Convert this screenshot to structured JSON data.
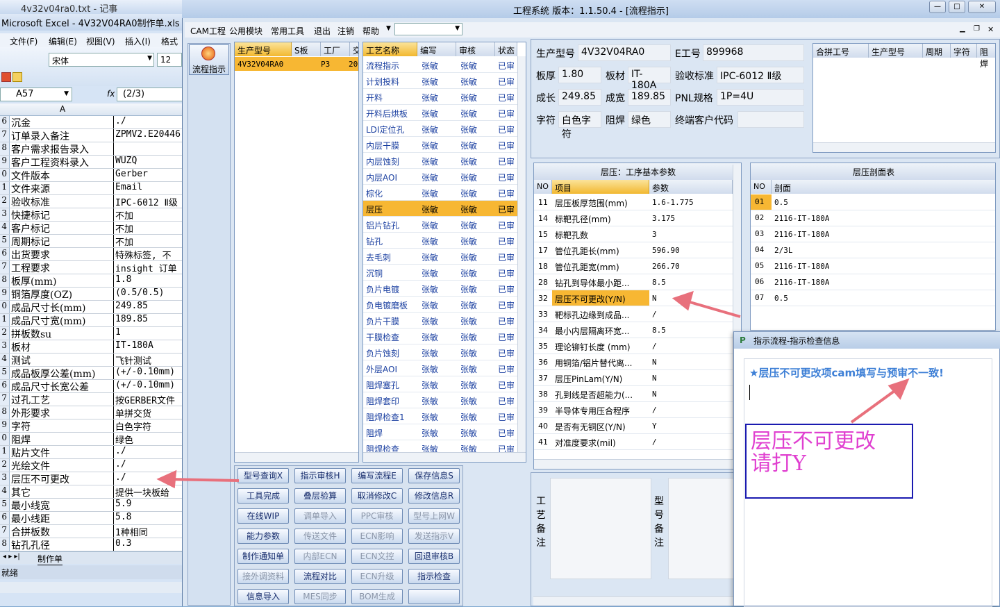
{
  "excel": {
    "title1": "4v32v04ra0.txt - 记事",
    "title2": "Microsoft Excel - 4V32V04RA0制作单.xls",
    "menu": [
      "文件(F)",
      "编辑(E)",
      "视图(V)",
      "插入(I)",
      "格式"
    ],
    "font": "宋体",
    "size": "12",
    "namebox": "A57",
    "fx_symbol": "fx",
    "formula": "(2/3)",
    "col_a": "A",
    "rows": [
      {
        "n": "6",
        "a": "沉金",
        "b": "./"
      },
      {
        "n": "7",
        "a": "订单录入备注",
        "b": "ZPMV2.E20446"
      },
      {
        "n": "8",
        "a": "客户需求报告录入",
        "b": ""
      },
      {
        "n": "9",
        "a": "客户工程资料录入",
        "b": "WUZQ"
      },
      {
        "n": "0",
        "a": "文件版本",
        "b": "Gerber"
      },
      {
        "n": "1",
        "a": "文件来源",
        "b": "Email"
      },
      {
        "n": "2",
        "a": "验收标准",
        "b": "IPC-6012 Ⅱ级"
      },
      {
        "n": "3",
        "a": "快捷标记",
        "b": "不加"
      },
      {
        "n": "4",
        "a": "客户标记",
        "b": "不加"
      },
      {
        "n": "5",
        "a": "周期标记",
        "b": "不加"
      },
      {
        "n": "6",
        "a": "出货要求",
        "b": "特殊标签, 不"
      },
      {
        "n": "7",
        "a": "工程要求",
        "b": "insight 订单"
      },
      {
        "n": "8",
        "a": "板厚(mm)",
        "b": "1.8"
      },
      {
        "n": "9",
        "a": "铜箔厚度(OZ)",
        "b": "(0.5/0.5)"
      },
      {
        "n": "0",
        "a": "成品尺寸长(mm)",
        "b": "249.85"
      },
      {
        "n": "1",
        "a": "成品尺寸宽(mm)",
        "b": "189.85"
      },
      {
        "n": "2",
        "a": "拼板数su",
        "b": "1"
      },
      {
        "n": "3",
        "a": "板材",
        "b": "IT-180A"
      },
      {
        "n": "4",
        "a": "测试",
        "b": "飞针测试"
      },
      {
        "n": "5",
        "a": "成品板厚公差(mm)",
        "b": "(+/-0.10mm)"
      },
      {
        "n": "6",
        "a": "成品尺寸长宽公差",
        "b": "(+/-0.10mm)"
      },
      {
        "n": "7",
        "a": "过孔工艺",
        "b": "按GERBER文件"
      },
      {
        "n": "8",
        "a": "外形要求",
        "b": "单拼交货"
      },
      {
        "n": "9",
        "a": "字符",
        "b": "白色字符"
      },
      {
        "n": "0",
        "a": "阻焊",
        "b": "绿色"
      },
      {
        "n": "1",
        "a": "贴片文件",
        "b": "./"
      },
      {
        "n": "2",
        "a": "光绘文件",
        "b": "./"
      },
      {
        "n": "3",
        "a": "层压不可更改",
        "b": "./"
      },
      {
        "n": "4",
        "a": "其它",
        "b": "提供一块板给"
      },
      {
        "n": "5",
        "a": "最小线宽",
        "b": "5.9"
      },
      {
        "n": "6",
        "a": "最小线距",
        "b": "5.8"
      },
      {
        "n": "7",
        "a": "合拼板数",
        "b": "1种相同"
      },
      {
        "n": "8",
        "a": "钻孔孔径",
        "b": "0.3"
      }
    ],
    "sheet_tab": "制作单",
    "status": "就绪"
  },
  "app": {
    "title": "工程系统   版本：1.1.50.4 - [流程指示]",
    "menu": [
      "CAM工程",
      "公用模块",
      "常用工具",
      "退出",
      "注销",
      "帮助"
    ],
    "left_button": "流程指示",
    "model_table": {
      "headers": [
        "生产型号",
        "S板",
        "工厂",
        "交"
      ],
      "rows": [
        [
          "4V32V04RA0",
          "",
          "P3",
          "20"
        ]
      ]
    },
    "process_table": {
      "headers": [
        "工艺名称",
        "编写",
        "审核",
        "状态"
      ],
      "rows": [
        [
          "流程指示",
          "张敏",
          "张敏",
          "已审"
        ],
        [
          "计划投料",
          "张敏",
          "张敏",
          "已审"
        ],
        [
          "开料",
          "张敏",
          "张敏",
          "已审"
        ],
        [
          "开料后烘板",
          "张敏",
          "张敏",
          "已审"
        ],
        [
          "LDI定位孔",
          "张敏",
          "张敏",
          "已审"
        ],
        [
          "内层干膜",
          "张敏",
          "张敏",
          "已审"
        ],
        [
          "内层蚀刻",
          "张敏",
          "张敏",
          "已审"
        ],
        [
          "内层AOI",
          "张敏",
          "张敏",
          "已审"
        ],
        [
          "棕化",
          "张敏",
          "张敏",
          "已审"
        ],
        [
          "层压",
          "张敏",
          "张敏",
          "已审"
        ],
        [
          "铝片钻孔",
          "张敏",
          "张敏",
          "已审"
        ],
        [
          "钻孔",
          "张敏",
          "张敏",
          "已审"
        ],
        [
          "去毛刺",
          "张敏",
          "张敏",
          "已审"
        ],
        [
          "沉铜",
          "张敏",
          "张敏",
          "已审"
        ],
        [
          "负片电镀",
          "张敏",
          "张敏",
          "已审"
        ],
        [
          "负电镀磨板",
          "张敏",
          "张敏",
          "已审"
        ],
        [
          "负片干膜",
          "张敏",
          "张敏",
          "已审"
        ],
        [
          "干膜检查",
          "张敏",
          "张敏",
          "已审"
        ],
        [
          "负片蚀刻",
          "张敏",
          "张敏",
          "已审"
        ],
        [
          "外层AOI",
          "张敏",
          "张敏",
          "已审"
        ],
        [
          "阻焊塞孔",
          "张敏",
          "张敏",
          "已审"
        ],
        [
          "阻焊套印",
          "张敏",
          "张敏",
          "已审"
        ],
        [
          "阻焊检查1",
          "张敏",
          "张敏",
          "已审"
        ],
        [
          "阻焊",
          "张敏",
          "张敏",
          "已审"
        ],
        [
          "阻焊检查",
          "张敏",
          "张敏",
          "已审"
        ]
      ],
      "selected_index": 9
    },
    "buttons": [
      [
        "型号查询X",
        "指示审核H",
        "编写流程E",
        "保存信息S"
      ],
      [
        "工具完成",
        "叠层验算",
        "取消修改C",
        "修改信息R"
      ],
      [
        "在线WIP",
        "调单导入",
        "PPC审核",
        "型号上网W"
      ],
      [
        "能力参数",
        "传送文件",
        "ECN影响",
        "发送指示V"
      ],
      [
        "制作通知单",
        "内部ECN",
        "ECN文控",
        "回退审核B"
      ],
      [
        "接外调资料",
        "流程对比",
        "ECN升级",
        "指示检查"
      ],
      [
        "信息导入",
        "MES同步",
        "BOM生成",
        ""
      ]
    ],
    "info": {
      "model_label": "生产型号",
      "model": "4V32V04RA0",
      "e_label": "E工号",
      "e": "899968",
      "thick_label": "板厚",
      "thick": "1.80",
      "mat_label": "板材",
      "mat": "IT-180A",
      "std_label": "验收标准",
      "std": "IPC-6012 Ⅱ级",
      "len_label": "成长",
      "len": "249.85",
      "wid_label": "成宽",
      "wid": "189.85",
      "pnl_label": "PNL规格",
      "pnl": "1P=4U",
      "char_label": "字符",
      "char": "白色字符",
      "mask_label": "阻焊",
      "mask": "绿色",
      "cust_label": "终端客户代码",
      "cust": ""
    },
    "combine_table": {
      "headers": [
        "合拼工号",
        "生产型号",
        "周期",
        "字符",
        "阻焊"
      ]
    },
    "params": {
      "title": "层压：工序基本参数",
      "headers": [
        "NO",
        "项目",
        "参数"
      ],
      "rows": [
        [
          "11",
          "层压板厚范围(mm)",
          "1.6-1.775"
        ],
        [
          "14",
          "标靶孔径(mm)",
          "3.175"
        ],
        [
          "15",
          "标靶孔数",
          "3"
        ],
        [
          "17",
          "管位孔距长(mm)",
          "596.90"
        ],
        [
          "18",
          "管位孔距宽(mm)",
          "266.70"
        ],
        [
          "28",
          "钻孔到导体最小距...",
          "8.5"
        ],
        [
          "32",
          "层压不可更改(Y/N)",
          "N"
        ],
        [
          "33",
          "靶标孔边缘到成品...",
          "/"
        ],
        [
          "34",
          "最小内层隔离环宽...",
          "8.5"
        ],
        [
          "35",
          "理论铆钉长度 (mm)",
          "/"
        ],
        [
          "36",
          "用铜箔/铝片替代离...",
          "N"
        ],
        [
          "37",
          "层压PinLam(Y/N)",
          "N"
        ],
        [
          "38",
          "孔到线是否超能力(...",
          "N"
        ],
        [
          "39",
          "半导体专用压合程序",
          "/"
        ],
        [
          "40",
          "是否有无铜区(Y/N)",
          "Y"
        ],
        [
          "41",
          "对准度要求(mil)",
          "/"
        ]
      ],
      "highlight_index": 6
    },
    "stackup": {
      "title": "层压剖面表",
      "headers": [
        "NO",
        "剖面"
      ],
      "rows": [
        [
          "01",
          "0.5"
        ],
        [
          "02",
          "2116-IT-180A"
        ],
        [
          "03",
          "2116-IT-180A"
        ],
        [
          "04",
          "2/3L"
        ],
        [
          "05",
          "2116-IT-180A"
        ],
        [
          "06",
          "2116-IT-180A"
        ],
        [
          "07",
          "0.5"
        ]
      ]
    },
    "remark_process": "工艺备注",
    "remark_model": "型号备注"
  },
  "dialog": {
    "title": "指示流程-指示检查信息",
    "message": "★层压不可更改项cam填写与预审不一致!"
  },
  "annotation": {
    "line1": "层压不可更改",
    "line2": "请打Y",
    "arrow_color": "#e8707c"
  },
  "colors": {
    "header_orange": "#f2b830",
    "selected_orange": "#f7b733",
    "title_blue": "#b4cbe8"
  }
}
